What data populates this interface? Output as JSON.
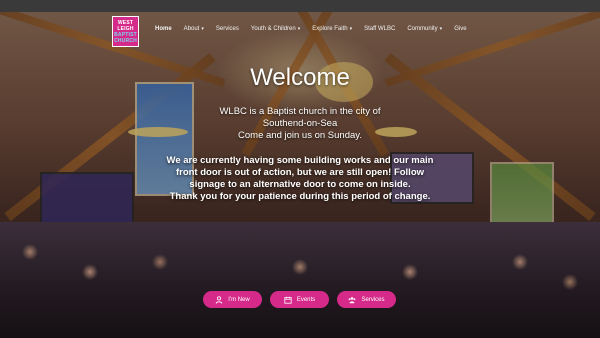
{
  "logo": {
    "line1": "WEST",
    "line2": "LEIGH",
    "line3": "BAPTIST",
    "line4": "CHURCH"
  },
  "nav": [
    {
      "label": "Home",
      "caret": false,
      "active": true
    },
    {
      "label": "About",
      "caret": true
    },
    {
      "label": "Services",
      "caret": false
    },
    {
      "label": "Youth & Children",
      "caret": true
    },
    {
      "label": "Explore Faith",
      "caret": true
    },
    {
      "label": "Staff WLBC",
      "caret": false
    },
    {
      "label": "Community",
      "caret": true
    },
    {
      "label": "Give",
      "caret": false
    }
  ],
  "hero": {
    "title": "Welcome",
    "intro_1": "WLBC is a Baptist church in the city of",
    "intro_2": "Southend-on-Sea",
    "intro_3": "Come and join us on Sunday.",
    "notice_1": "We are currently having some building works and our main front door is out of action, but we are still open! Follow signage to an alternative door to come on inside.",
    "notice_2": "Thank you for your patience during this period of change."
  },
  "buttons": {
    "im_new": {
      "label": "I'm New",
      "icon": "user-icon"
    },
    "events": {
      "label": "Events",
      "icon": "calendar-icon"
    },
    "services": {
      "label": "Services",
      "icon": "people-icon"
    }
  },
  "colors": {
    "accent": "#d62a8a",
    "logo_text_accent": "#7dd3f0"
  }
}
